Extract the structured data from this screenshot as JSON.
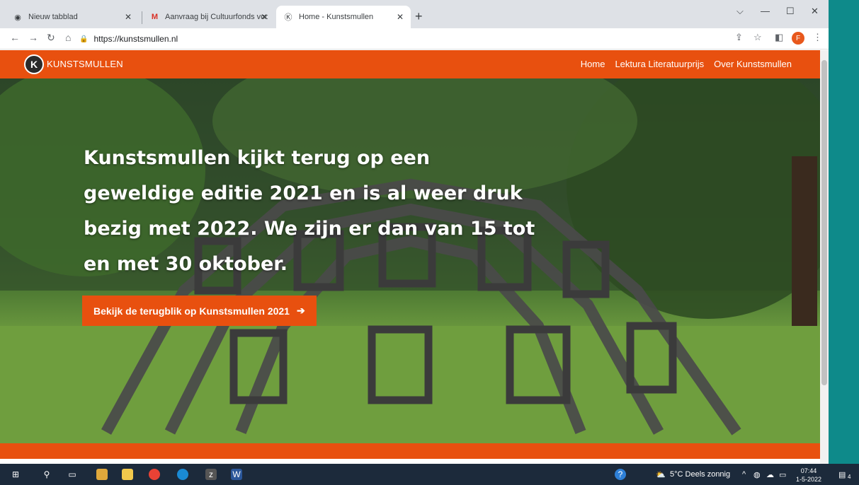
{
  "browser": {
    "tabs": [
      {
        "label": "Nieuw tabblad",
        "icon": "chrome-icon"
      },
      {
        "label": "Aanvraag bij Cultuurfonds voortz",
        "icon": "gmail-icon"
      },
      {
        "label": "Home - Kunstsmullen",
        "icon": "kunstsmullen-icon"
      }
    ],
    "url": "https://kunstsmullen.nl",
    "profile_initial": "F"
  },
  "site": {
    "brand": "KUNSTSMULLEN",
    "nav": [
      "Home",
      "Lektura Literatuurprijs",
      "Over Kunstsmullen"
    ],
    "headline": "Kunstsmullen kijkt terug op een geweldige editie 2021 en is al weer druk bezig met 2022. We zijn er dan van 15 tot en met 30 oktober.",
    "cta": "Bekijk de terugblik op Kunstsmullen 2021",
    "accent_color": "#e8500f"
  },
  "taskbar": {
    "weather": "5°C Deels zonnig",
    "time": "07:44",
    "date": "1-5-2022",
    "notifications": "4"
  }
}
